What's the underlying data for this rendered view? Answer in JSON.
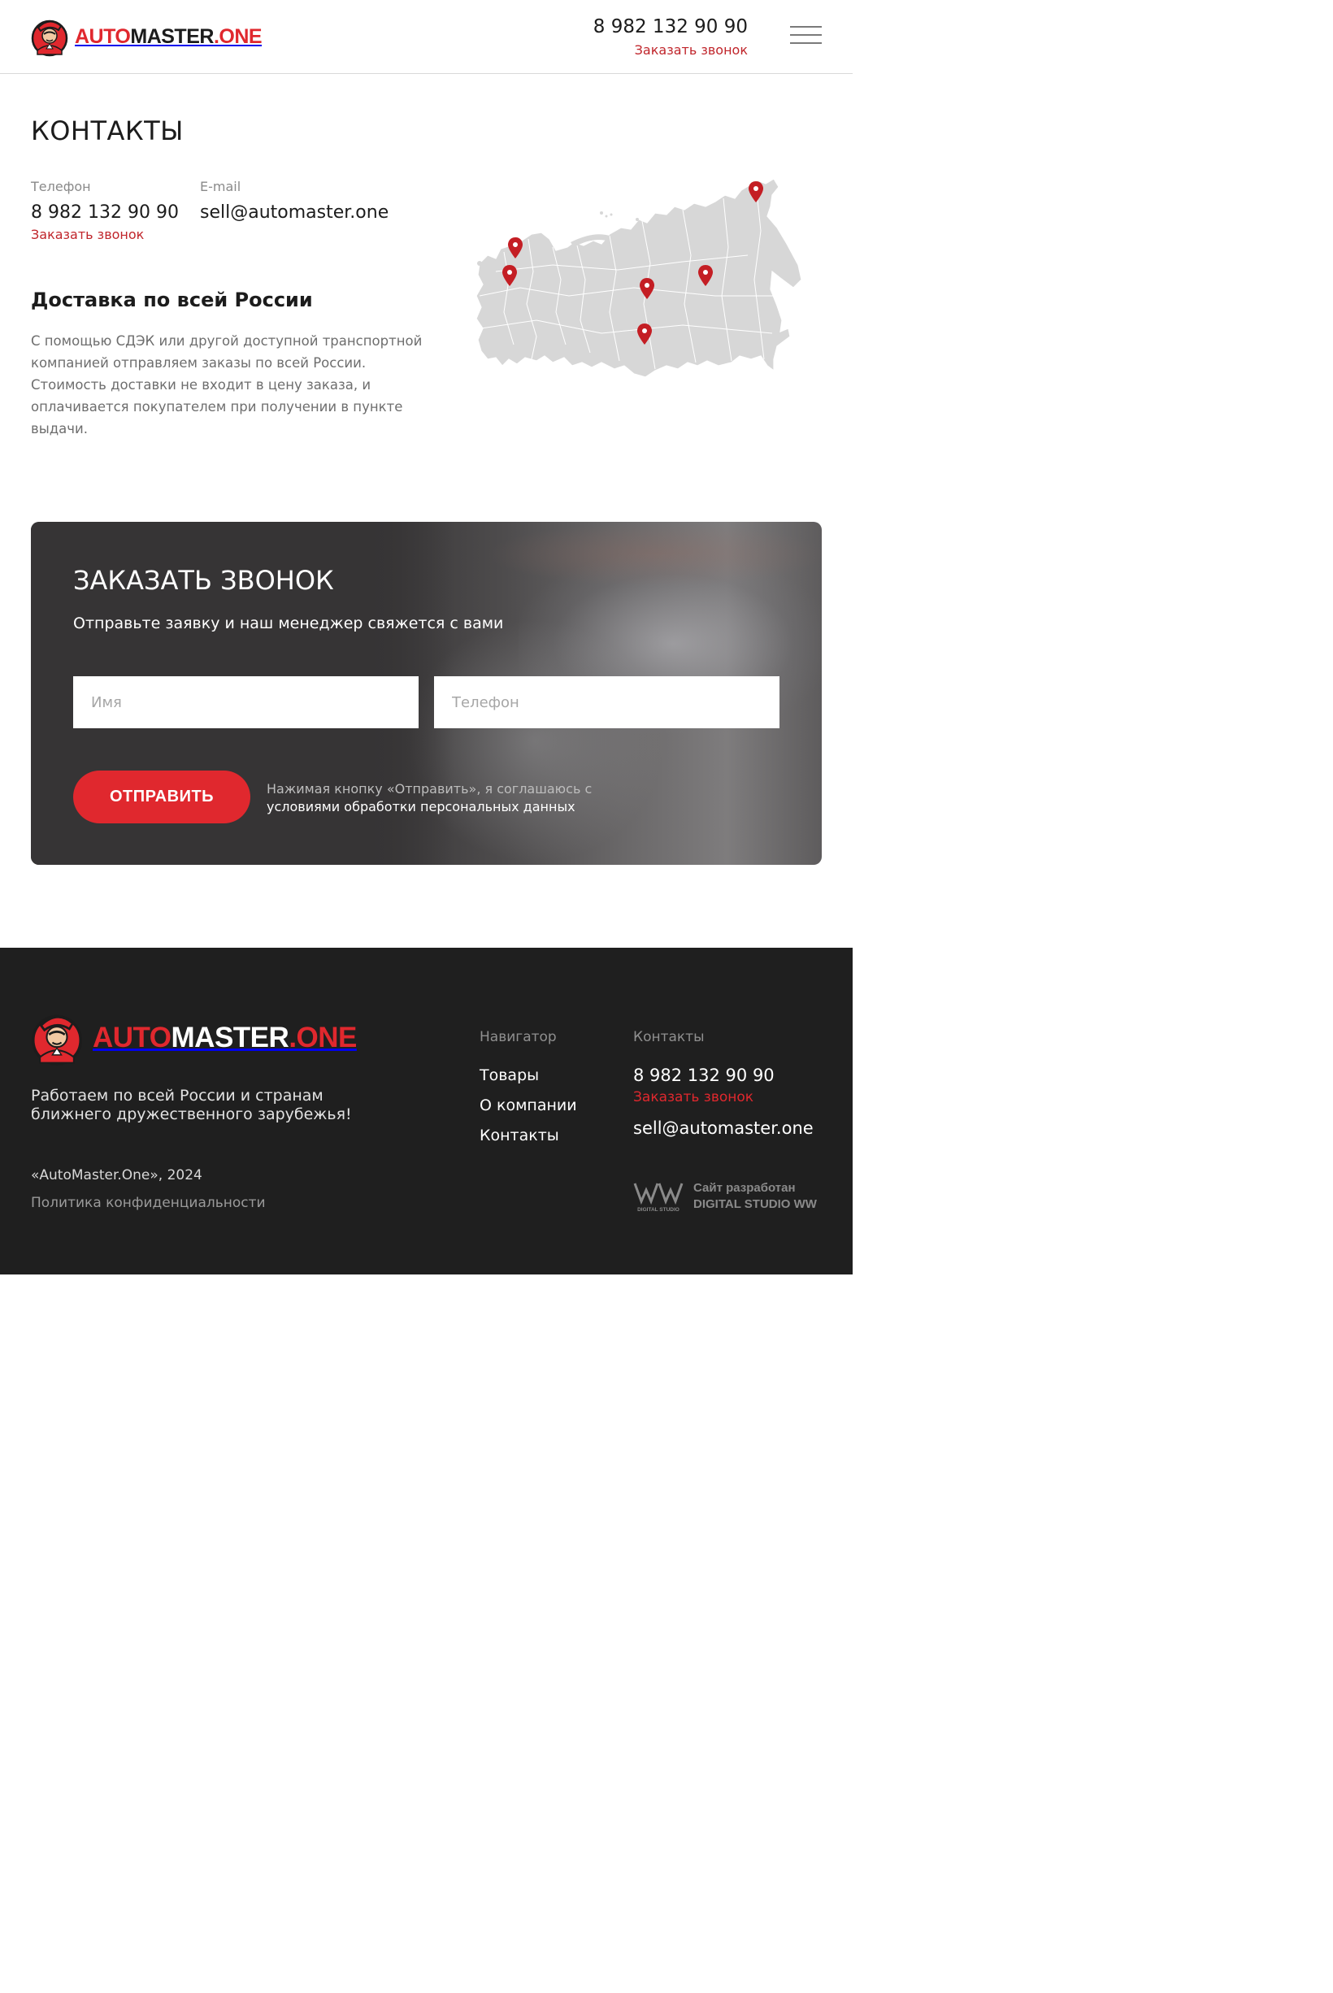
{
  "brand": {
    "logo_part_red": "AUTO",
    "logo_part_main": "MASTER",
    "logo_part_end": ".ONE",
    "mascot_icon": "mechanic-mascot-icon",
    "accent_color": "#e0282e"
  },
  "header": {
    "phone": "8 982 132 90 90",
    "callback_link": "Заказать звонок",
    "menu_icon": "hamburger-menu-icon"
  },
  "contacts": {
    "title": "КОНТАКТЫ",
    "phone_label": "Телефон",
    "phone": "8 982 132 90 90",
    "callback_link": "Заказать звонок",
    "email_label": "E-mail",
    "email": "sell@automaster.one"
  },
  "delivery": {
    "title": "Доставка по всей России",
    "text": "С помощью СДЭК или другой доступной транспортной компанией отправляем заказы по всей России. Стоимость доставки не входит в цену заказа, и оплачивается покупателем при получении в пункте выдачи.",
    "map_icon": "russia-map-icon",
    "pin_icon": "map-pin-icon"
  },
  "callback_form": {
    "title": "ЗАКАЗАТЬ ЗВОНОК",
    "subtitle": "Отправьте заявку и наш менеджер свяжется с вами",
    "name_placeholder": "Имя",
    "phone_placeholder": "Телефон",
    "submit_label": "ОТПРАВИТЬ",
    "consent_text": "Нажимая кнопку «Отправить», я соглашаюсь с",
    "consent_link": "условиями обработки персональных данных"
  },
  "footer": {
    "tagline": "Работаем по всей России и странам ближнего дружественного зарубежья!",
    "copyright": "«AutoMaster.One», 2024",
    "privacy_link": "Политика конфиденциальности",
    "nav_heading": "Навигатор",
    "nav_items": [
      "Товары",
      "О компании",
      "Контакты"
    ],
    "contacts_heading": "Контакты",
    "phone": "8 982 132 90 90",
    "callback_link": "Заказать звонок",
    "email": "sell@automaster.one",
    "dev_line1": "Сайт разработан",
    "dev_line2": "DIGITAL STUDIO WW",
    "dev_logo_caption": "DIGITAL STUDIO"
  }
}
